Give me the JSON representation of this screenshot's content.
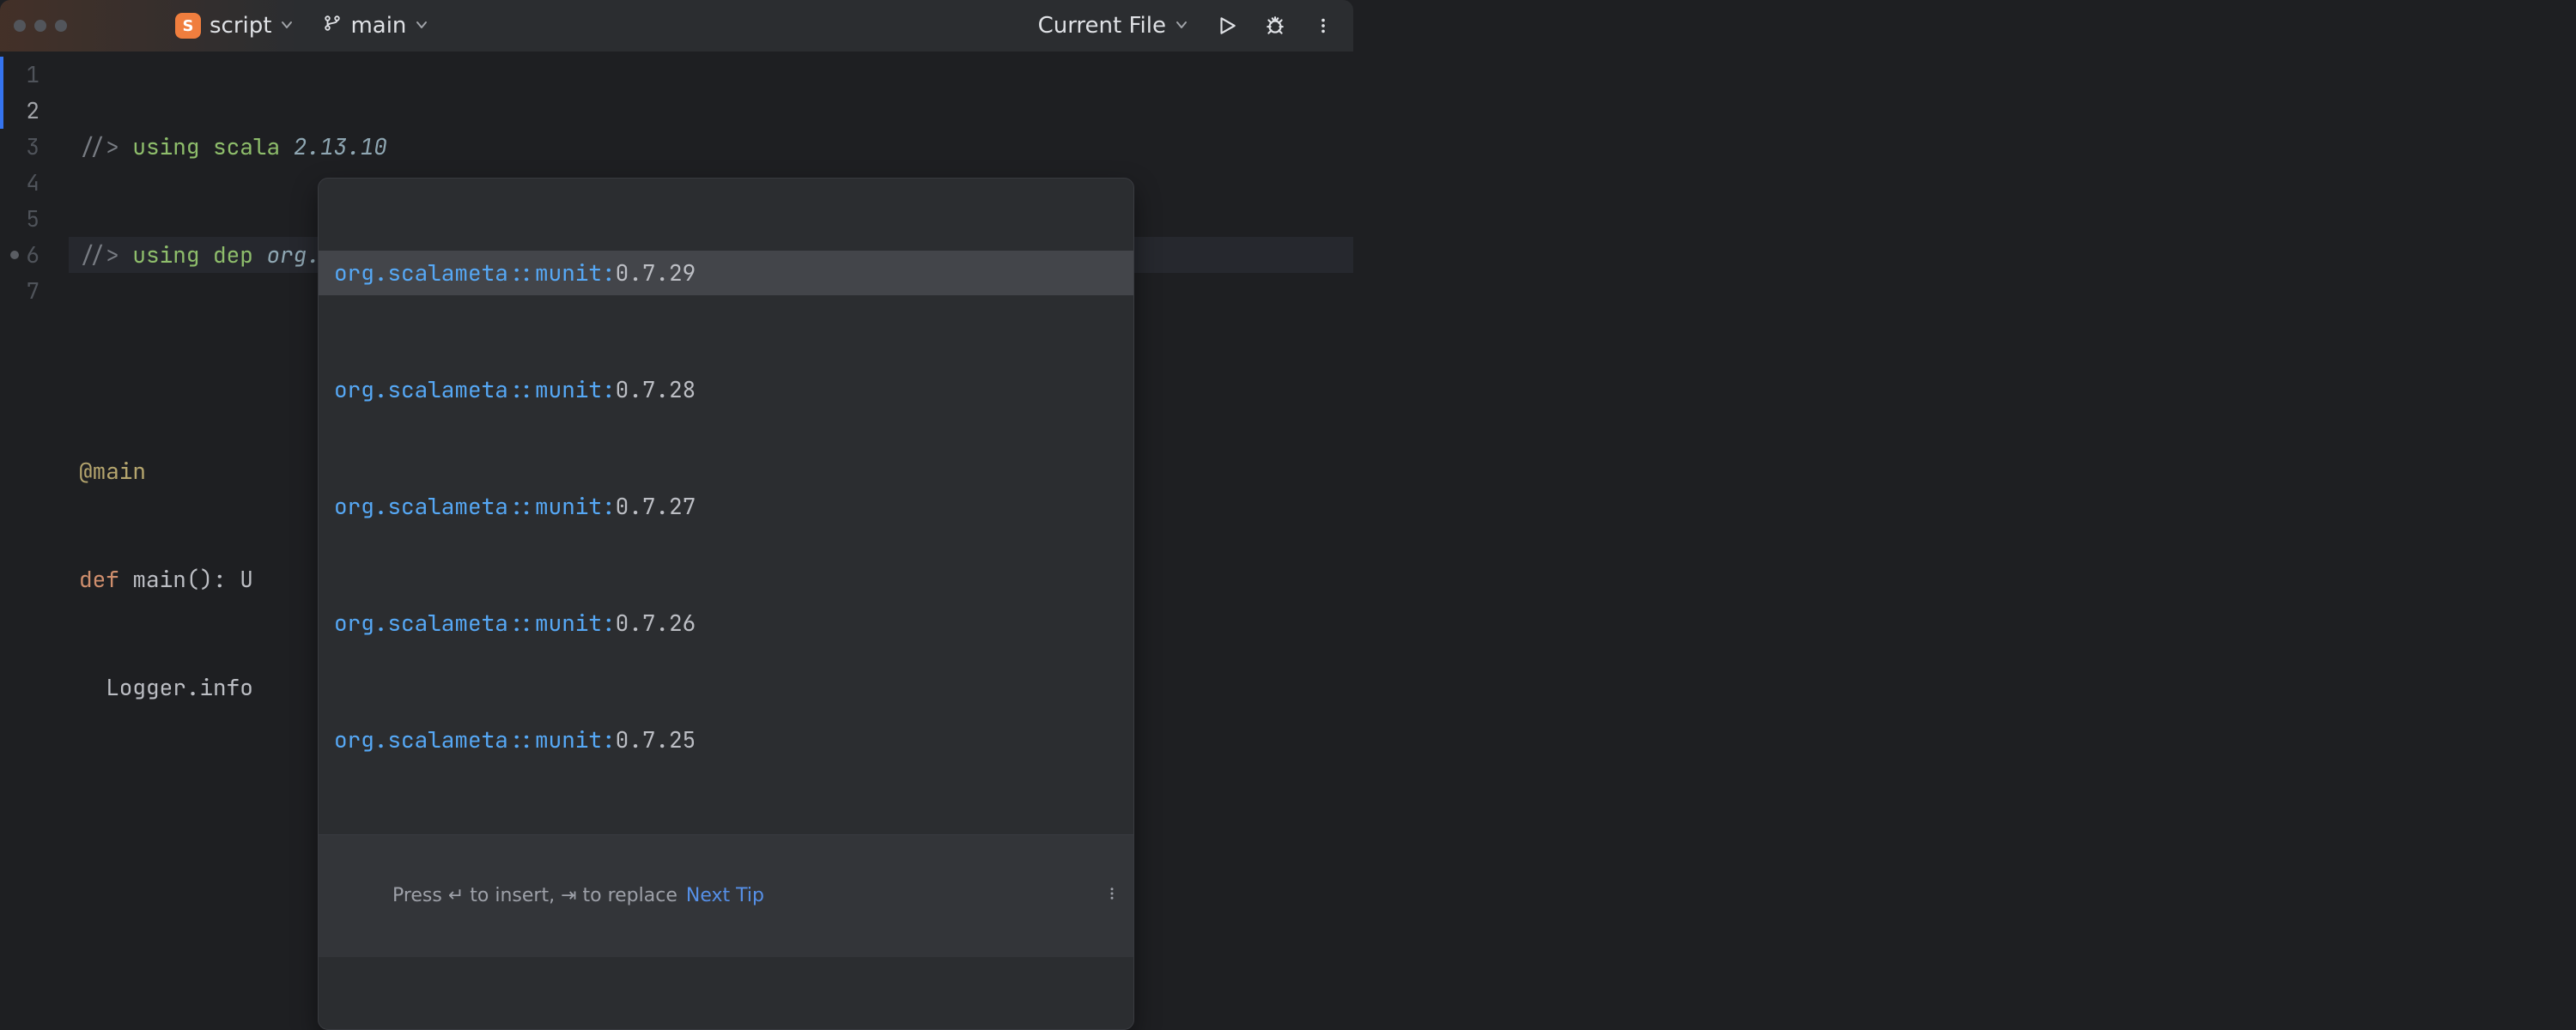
{
  "toolbar": {
    "file_icon_letter": "S",
    "file_label": "script",
    "branch_label": "main",
    "run_config_label": "Current File"
  },
  "editor": {
    "lines": {
      "l1_comment": "//>",
      "l1_kw1": "using",
      "l1_kw2": "scala",
      "l1_ver": "2.13.10",
      "l2_comment": "//>",
      "l2_kw1": "using",
      "l2_kw2": "dep",
      "l2_dep": "org.scalameta::munit:",
      "l4_ann": "@main",
      "l5_def": "def",
      "l5_sig": "main(): U",
      "l6_text": "  Logger.info"
    },
    "gutter": [
      "1",
      "2",
      "3",
      "4",
      "5",
      "6",
      "7"
    ],
    "active_line_index": 1
  },
  "completion": {
    "prefix": "org.scalameta::munit:",
    "items": [
      {
        "version": "0.7.29",
        "selected": true
      },
      {
        "version": "0.7.28",
        "selected": false
      },
      {
        "version": "0.7.27",
        "selected": false
      },
      {
        "version": "0.7.26",
        "selected": false
      },
      {
        "version": "0.7.25",
        "selected": false
      }
    ],
    "hint_pre": "Press ",
    "hint_insert": "↵",
    "hint_mid": " to insert, ",
    "hint_replace": "⇥",
    "hint_post": " to replace",
    "next_tip": "Next Tip"
  }
}
